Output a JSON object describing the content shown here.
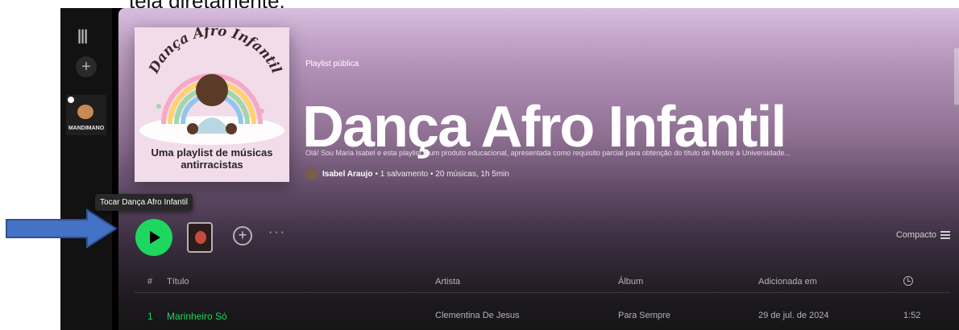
{
  "doc_caption": "tela diretamente.",
  "sidebar": {
    "library_icon": "library-icon",
    "create_icon": "plus-icon",
    "thumb_label": "MANDIMANO"
  },
  "playlist": {
    "cover": {
      "title": "Dança Afro Infantil",
      "subtitle_line1": "Uma playlist de músicas",
      "subtitle_line2": "antirracistas"
    },
    "type_label": "Playlist pública",
    "title": "Dança Afro Infantil",
    "description": "Olá! Sou Maria Isabel e esta playlist é um produto educacional, apresentada como requisito parcial para obtenção do título de Mestre à Universidade...",
    "owner": "Isabel Araujo",
    "meta": "• 1 salvamento • 20 músicas, 1h 5min"
  },
  "controls": {
    "tooltip": "Tocar Dança Afro Infantil",
    "more": "···",
    "view_label": "Compacto"
  },
  "table": {
    "headers": {
      "num": "#",
      "title": "Título",
      "artist": "Artista",
      "album": "Álbum",
      "added": "Adicionada em"
    },
    "rows": [
      {
        "num": "1",
        "title": "Marinheiro Só",
        "artist": "Clementina De Jesus",
        "album": "Para Sempre",
        "added": "29 de jul. de 2024",
        "duration": "1:52"
      }
    ]
  },
  "colors": {
    "accent_green": "#1ed760",
    "annotation_arrow": "#4472c4"
  }
}
